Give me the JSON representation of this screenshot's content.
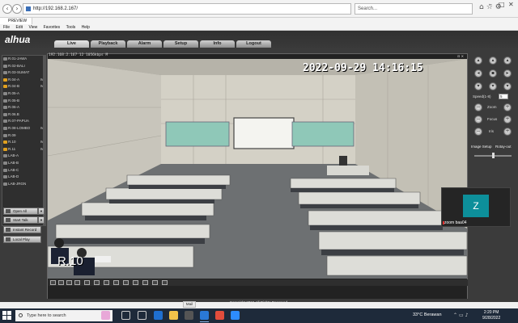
{
  "browser": {
    "url": "http://192.168.2.167/",
    "search_placeholder": "Search...",
    "tab_title": "PREVIEW",
    "menu": [
      "File",
      "Edit",
      "View",
      "Favorites",
      "Tools",
      "Help"
    ]
  },
  "app": {
    "logo": "alhua",
    "tabs": [
      "Live",
      "Playback",
      "Alarm",
      "Setup",
      "Info",
      "Logout"
    ],
    "active_tab": "Live"
  },
  "channels": [
    {
      "label": "R.01-JAWA",
      "on": false,
      "mark": ""
    },
    {
      "label": "R.02-BALI",
      "on": false,
      "mark": ""
    },
    {
      "label": "R.03-SUMAT",
      "on": false,
      "mark": ""
    },
    {
      "label": "R.04-A",
      "on": true,
      "mark": "M"
    },
    {
      "label": "R.04-B",
      "on": true,
      "mark": "M"
    },
    {
      "label": "R.05-A",
      "on": false,
      "mark": ""
    },
    {
      "label": "R.05-B",
      "on": false,
      "mark": ""
    },
    {
      "label": "R.06-A",
      "on": false,
      "mark": ""
    },
    {
      "label": "R.06.B",
      "on": false,
      "mark": ""
    },
    {
      "label": "R.07-PAPUA",
      "on": false,
      "mark": ""
    },
    {
      "label": "R.08-LOMBO",
      "on": false,
      "mark": "M"
    },
    {
      "label": "R.09",
      "on": false,
      "mark": ""
    },
    {
      "label": "R.10",
      "on": true,
      "mark": "M"
    },
    {
      "label": "R.11",
      "on": true,
      "mark": "M"
    },
    {
      "label": "LAB-A",
      "on": false,
      "mark": ""
    },
    {
      "label": "LAB-B",
      "on": false,
      "mark": ""
    },
    {
      "label": "LAB-C",
      "on": false,
      "mark": ""
    },
    {
      "label": "LAB-D",
      "on": false,
      "mark": ""
    },
    {
      "label": "LAB-JRGN",
      "on": false,
      "mark": ""
    }
  ],
  "side_buttons": {
    "open_all": "Open All",
    "start_talk": "Start Talk",
    "instant_record": "Instant Record",
    "local_play": "Local Play"
  },
  "video": {
    "info": "192.168.2.167 12 1056kbps M",
    "timestamp": "2022-09-29 14:16:15",
    "camera_label": "R.10"
  },
  "ptz": {
    "speed_label": "Speed(1-8)",
    "speed_value": "5",
    "zoom_label": "Zoom",
    "focus_label": "Focus",
    "iris_label": "Iris"
  },
  "image_setup": {
    "title": "Image Setup",
    "rotate": "Rotay-out"
  },
  "zoom_overlay": {
    "initial": "Z",
    "name": "zoom baa04"
  },
  "copyright": "Copyright 2015,All Rights Reserved.",
  "statusbar": {
    "mail": "Mail"
  },
  "taskbar": {
    "search_placeholder": "Type here to search",
    "weather": "33°C Berawan",
    "time": "2:20 PM",
    "date": "9/28/2022"
  }
}
